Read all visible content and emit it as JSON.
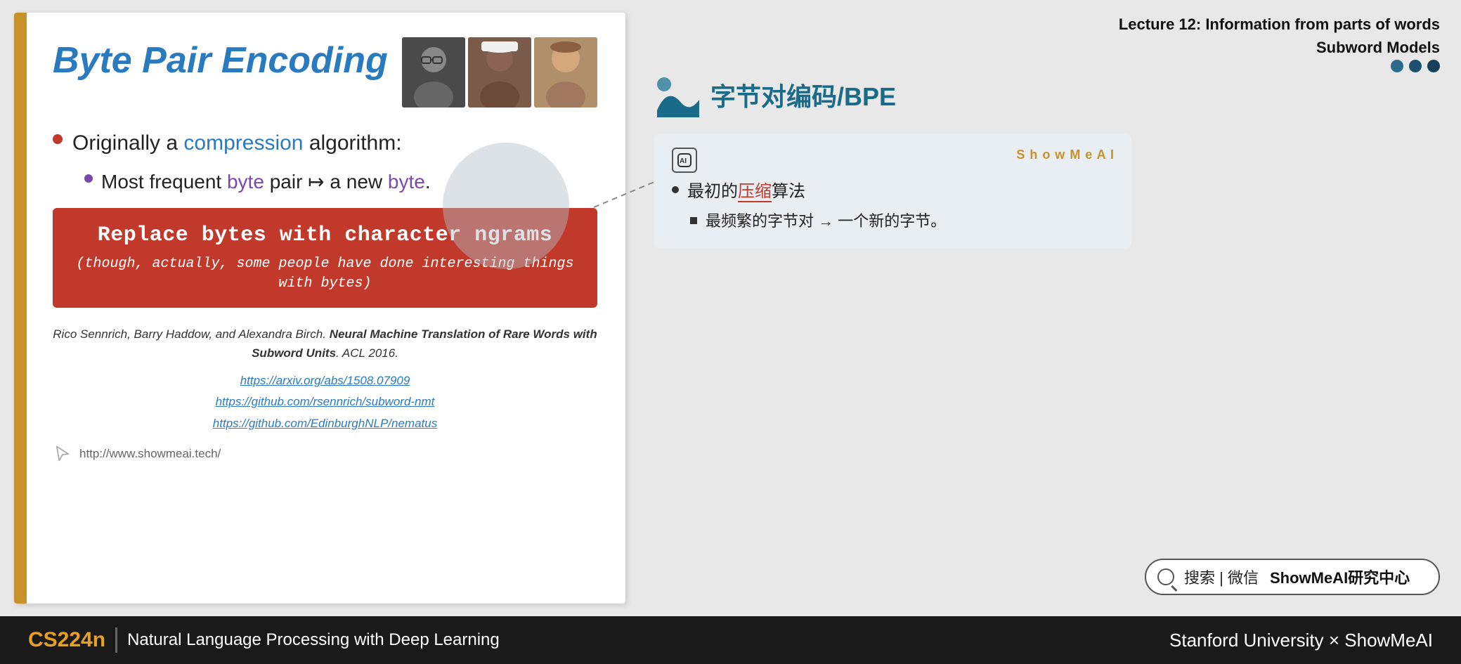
{
  "header": {
    "lecture_line1": "Lecture 12: Information from parts of words",
    "lecture_line2": "Subword Models"
  },
  "chapter": {
    "title": "字节对编码/BPE"
  },
  "slide": {
    "title": "Byte Pair Encoding",
    "left_bar_color": "#c8922a",
    "bullet1": {
      "prefix": "Originally a ",
      "highlight": "compression",
      "suffix": " algorithm:"
    },
    "bullet2": {
      "prefix": "Most frequent ",
      "highlight1": "byte",
      "middle": " pair ↦ a new ",
      "highlight2": "byte",
      "suffix": "."
    },
    "red_box": {
      "main": "Replace bytes with character ngrams",
      "sub": "(though, actually, some people have done interesting things with bytes)"
    },
    "citation": {
      "text_italic": "Rico Sennrich, Barry Haddow, and Alexandra Birch.",
      "text_bold": "Neural Machine Translation of Rare Words with Subword Units",
      "text_suffix": ". ACL 2016."
    },
    "links": [
      "https://arxiv.org/abs/1508.07909",
      "https://github.com/rsennrich/subword-nmt",
      "https://github.com/EdinburghNLP/nematus"
    ],
    "footer_url": "http://www.showmeai.tech/"
  },
  "ai_card": {
    "watermark": "S h o w M e A I",
    "bullet1_prefix": "最初的",
    "bullet1_highlight": "压缩",
    "bullet1_suffix": "算法",
    "sub_bullet": "最频繁的字节对 → 一个新的字节。"
  },
  "search_bar": {
    "icon_label": "search-icon",
    "text": "搜索 | 微信",
    "brand": "ShowMeAI研究中心"
  },
  "bottom_bar": {
    "course_code": "CS224n",
    "subtitle": "Natural Language Processing with Deep Learning",
    "right_text": "Stanford University × ShowMeAI"
  }
}
